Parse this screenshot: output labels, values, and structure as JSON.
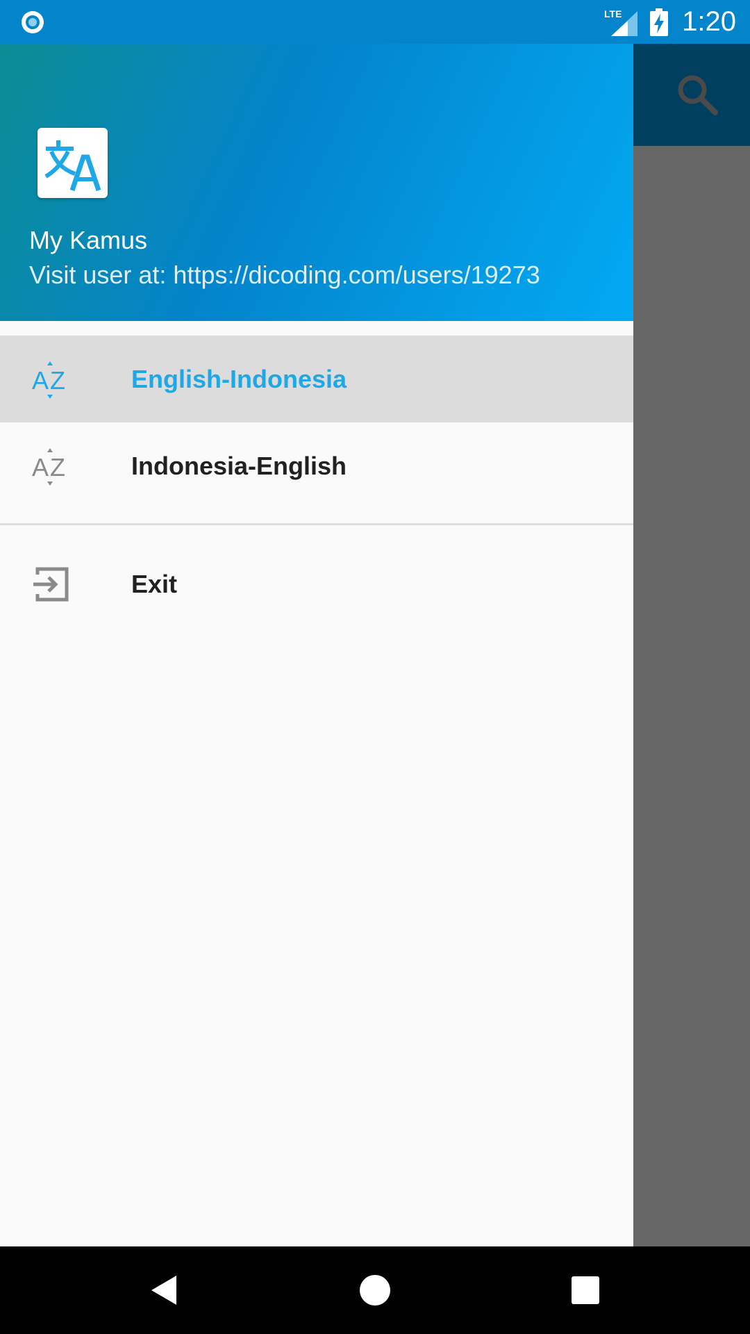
{
  "status_bar": {
    "time": "1:20",
    "network": "LTE",
    "icons": [
      "notification-dot-icon",
      "lte-signal-icon",
      "battery-charging-icon"
    ]
  },
  "toolbar": {
    "icons": [
      "search-icon"
    ]
  },
  "drawer": {
    "header": {
      "logo_icon": "translate-icon",
      "title": "My Kamus",
      "subtitle": "Visit user at: https://dicoding.com/users/19273"
    },
    "items": [
      {
        "label": "English-Indonesia",
        "icon": "sort-az-icon",
        "selected": true
      },
      {
        "label": "Indonesia-English",
        "icon": "sort-az-icon",
        "selected": false
      }
    ],
    "exit": {
      "label": "Exit",
      "icon": "exit-icon"
    }
  },
  "nav_bar": {
    "buttons": [
      "back-icon",
      "home-icon",
      "recents-icon"
    ]
  },
  "colors": {
    "status_bar": "#0384CB",
    "accent": "#1FA8E8",
    "header_start": "#0D8C94",
    "header_end": "#03A9F4",
    "selected_bg": "#DCDCDC",
    "scrim": "#666666"
  }
}
